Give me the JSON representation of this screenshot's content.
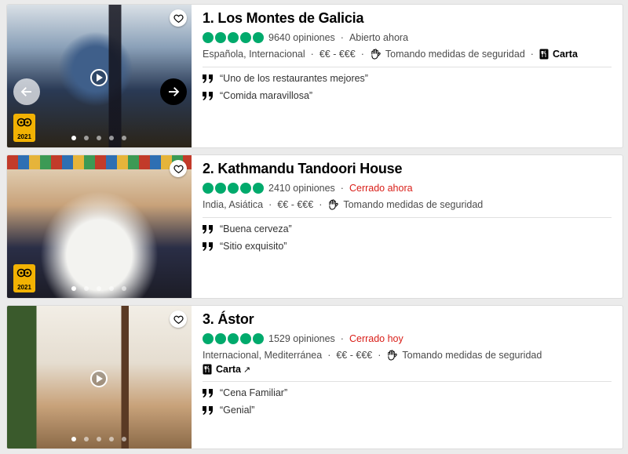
{
  "restaurants": [
    {
      "title": "1. Los Montes de Galicia",
      "reviews": "9640 opiniones",
      "status": "Abierto ahora",
      "cuisine": "Española, Internacional",
      "price": "€€ - €€€",
      "safety": "Tomando medidas de seguridad",
      "menu_label": "Carta",
      "award_year": "2021",
      "quotes": [
        "“Uno de los restaurantes mejores”",
        "“Comida maravillosa”"
      ],
      "rating": 5
    },
    {
      "title": "2. Kathmandu Tandoori House",
      "reviews": "2410 opiniones",
      "status": "Cerrado ahora",
      "cuisine": "India, Asiática",
      "price": "€€ - €€€",
      "safety": "Tomando medidas de seguridad",
      "award_year": "2021",
      "quotes": [
        "“Buena cerveza”",
        "“Sitio exquisito”"
      ],
      "rating": 5
    },
    {
      "title": "3. Ástor",
      "reviews": "1529 opiniones",
      "status": "Cerrado hoy",
      "cuisine": "Internacional, Mediterránea",
      "price": "€€ - €€€",
      "safety": "Tomando medidas de seguridad",
      "menu_label": "Carta",
      "quotes": [
        "“Cena Familiar”",
        "“Genial”"
      ],
      "rating": 5
    }
  ],
  "colors": {
    "bubble": "#00aa6c",
    "closed": "#d91e18",
    "award": "#f2b203"
  }
}
